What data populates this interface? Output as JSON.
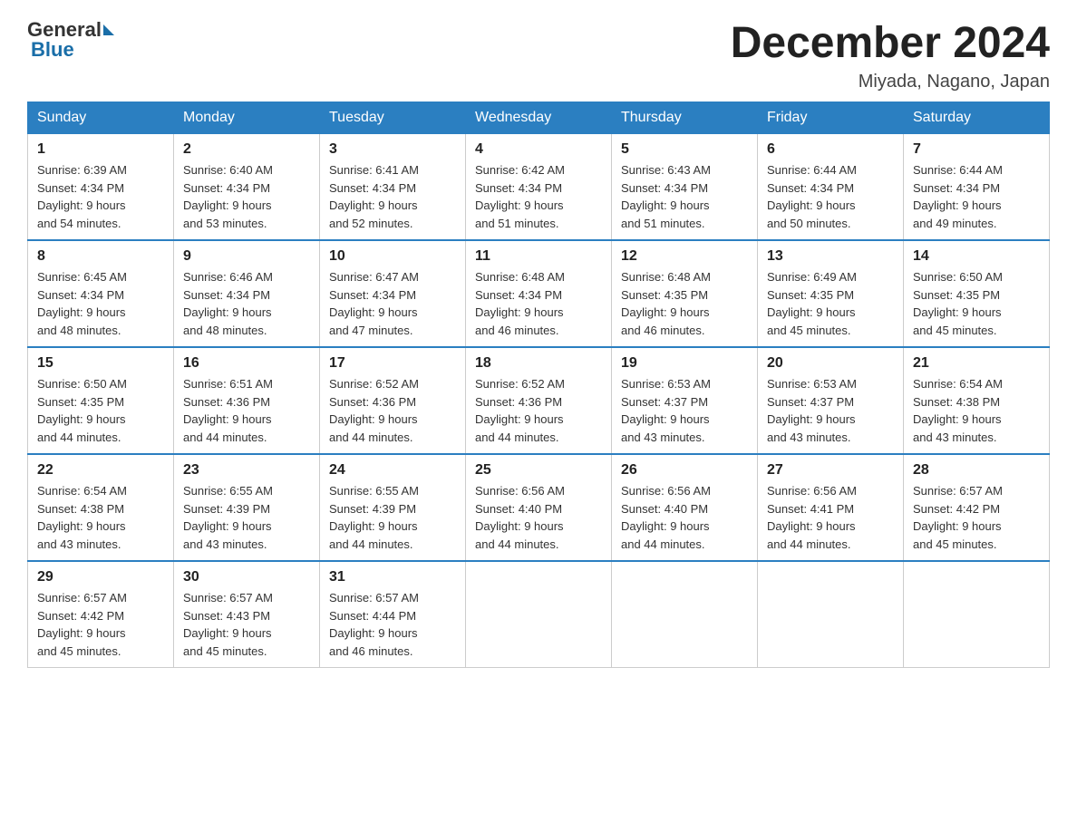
{
  "header": {
    "logo_general": "General",
    "logo_blue": "Blue",
    "month_title": "December 2024",
    "location": "Miyada, Nagano, Japan"
  },
  "days_of_week": [
    "Sunday",
    "Monday",
    "Tuesday",
    "Wednesday",
    "Thursday",
    "Friday",
    "Saturday"
  ],
  "weeks": [
    [
      {
        "day": "1",
        "sunrise": "6:39 AM",
        "sunset": "4:34 PM",
        "daylight": "9 hours and 54 minutes."
      },
      {
        "day": "2",
        "sunrise": "6:40 AM",
        "sunset": "4:34 PM",
        "daylight": "9 hours and 53 minutes."
      },
      {
        "day": "3",
        "sunrise": "6:41 AM",
        "sunset": "4:34 PM",
        "daylight": "9 hours and 52 minutes."
      },
      {
        "day": "4",
        "sunrise": "6:42 AM",
        "sunset": "4:34 PM",
        "daylight": "9 hours and 51 minutes."
      },
      {
        "day": "5",
        "sunrise": "6:43 AM",
        "sunset": "4:34 PM",
        "daylight": "9 hours and 51 minutes."
      },
      {
        "day": "6",
        "sunrise": "6:44 AM",
        "sunset": "4:34 PM",
        "daylight": "9 hours and 50 minutes."
      },
      {
        "day": "7",
        "sunrise": "6:44 AM",
        "sunset": "4:34 PM",
        "daylight": "9 hours and 49 minutes."
      }
    ],
    [
      {
        "day": "8",
        "sunrise": "6:45 AM",
        "sunset": "4:34 PM",
        "daylight": "9 hours and 48 minutes."
      },
      {
        "day": "9",
        "sunrise": "6:46 AM",
        "sunset": "4:34 PM",
        "daylight": "9 hours and 48 minutes."
      },
      {
        "day": "10",
        "sunrise": "6:47 AM",
        "sunset": "4:34 PM",
        "daylight": "9 hours and 47 minutes."
      },
      {
        "day": "11",
        "sunrise": "6:48 AM",
        "sunset": "4:34 PM",
        "daylight": "9 hours and 46 minutes."
      },
      {
        "day": "12",
        "sunrise": "6:48 AM",
        "sunset": "4:35 PM",
        "daylight": "9 hours and 46 minutes."
      },
      {
        "day": "13",
        "sunrise": "6:49 AM",
        "sunset": "4:35 PM",
        "daylight": "9 hours and 45 minutes."
      },
      {
        "day": "14",
        "sunrise": "6:50 AM",
        "sunset": "4:35 PM",
        "daylight": "9 hours and 45 minutes."
      }
    ],
    [
      {
        "day": "15",
        "sunrise": "6:50 AM",
        "sunset": "4:35 PM",
        "daylight": "9 hours and 44 minutes."
      },
      {
        "day": "16",
        "sunrise": "6:51 AM",
        "sunset": "4:36 PM",
        "daylight": "9 hours and 44 minutes."
      },
      {
        "day": "17",
        "sunrise": "6:52 AM",
        "sunset": "4:36 PM",
        "daylight": "9 hours and 44 minutes."
      },
      {
        "day": "18",
        "sunrise": "6:52 AM",
        "sunset": "4:36 PM",
        "daylight": "9 hours and 44 minutes."
      },
      {
        "day": "19",
        "sunrise": "6:53 AM",
        "sunset": "4:37 PM",
        "daylight": "9 hours and 43 minutes."
      },
      {
        "day": "20",
        "sunrise": "6:53 AM",
        "sunset": "4:37 PM",
        "daylight": "9 hours and 43 minutes."
      },
      {
        "day": "21",
        "sunrise": "6:54 AM",
        "sunset": "4:38 PM",
        "daylight": "9 hours and 43 minutes."
      }
    ],
    [
      {
        "day": "22",
        "sunrise": "6:54 AM",
        "sunset": "4:38 PM",
        "daylight": "9 hours and 43 minutes."
      },
      {
        "day": "23",
        "sunrise": "6:55 AM",
        "sunset": "4:39 PM",
        "daylight": "9 hours and 43 minutes."
      },
      {
        "day": "24",
        "sunrise": "6:55 AM",
        "sunset": "4:39 PM",
        "daylight": "9 hours and 44 minutes."
      },
      {
        "day": "25",
        "sunrise": "6:56 AM",
        "sunset": "4:40 PM",
        "daylight": "9 hours and 44 minutes."
      },
      {
        "day": "26",
        "sunrise": "6:56 AM",
        "sunset": "4:40 PM",
        "daylight": "9 hours and 44 minutes."
      },
      {
        "day": "27",
        "sunrise": "6:56 AM",
        "sunset": "4:41 PM",
        "daylight": "9 hours and 44 minutes."
      },
      {
        "day": "28",
        "sunrise": "6:57 AM",
        "sunset": "4:42 PM",
        "daylight": "9 hours and 45 minutes."
      }
    ],
    [
      {
        "day": "29",
        "sunrise": "6:57 AM",
        "sunset": "4:42 PM",
        "daylight": "9 hours and 45 minutes."
      },
      {
        "day": "30",
        "sunrise": "6:57 AM",
        "sunset": "4:43 PM",
        "daylight": "9 hours and 45 minutes."
      },
      {
        "day": "31",
        "sunrise": "6:57 AM",
        "sunset": "4:44 PM",
        "daylight": "9 hours and 46 minutes."
      },
      null,
      null,
      null,
      null
    ]
  ],
  "labels": {
    "sunrise": "Sunrise:",
    "sunset": "Sunset:",
    "daylight": "Daylight:"
  }
}
